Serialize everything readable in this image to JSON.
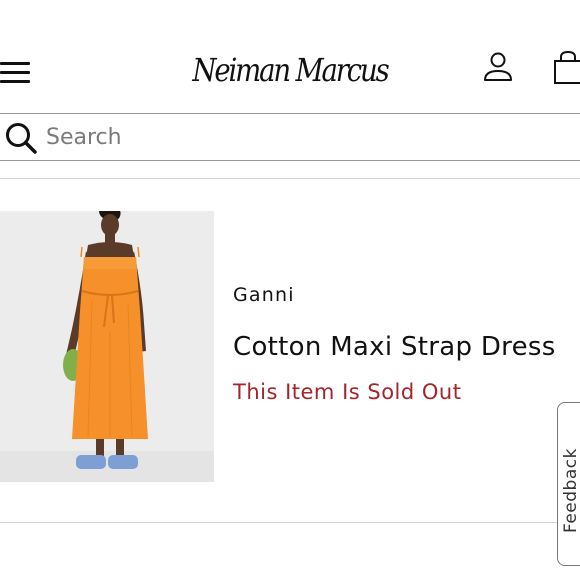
{
  "header": {
    "logo_text": "Neiman Marcus",
    "icons": {
      "menu": "hamburger-menu-icon",
      "account": "user-icon",
      "bag": "shopping-bag-icon"
    }
  },
  "search": {
    "placeholder": "Search",
    "value": "",
    "icon": "search-icon"
  },
  "product": {
    "brand": "Ganni",
    "title": "Cotton Maxi Strap Dress",
    "status": "This Item Is Sold Out"
  },
  "feedback": {
    "label": "Feedback"
  },
  "colors": {
    "sold_out_text": "#a4242c",
    "dress_orange": "#f5902a",
    "text": "#111111",
    "divider": "#d4d4d4"
  }
}
